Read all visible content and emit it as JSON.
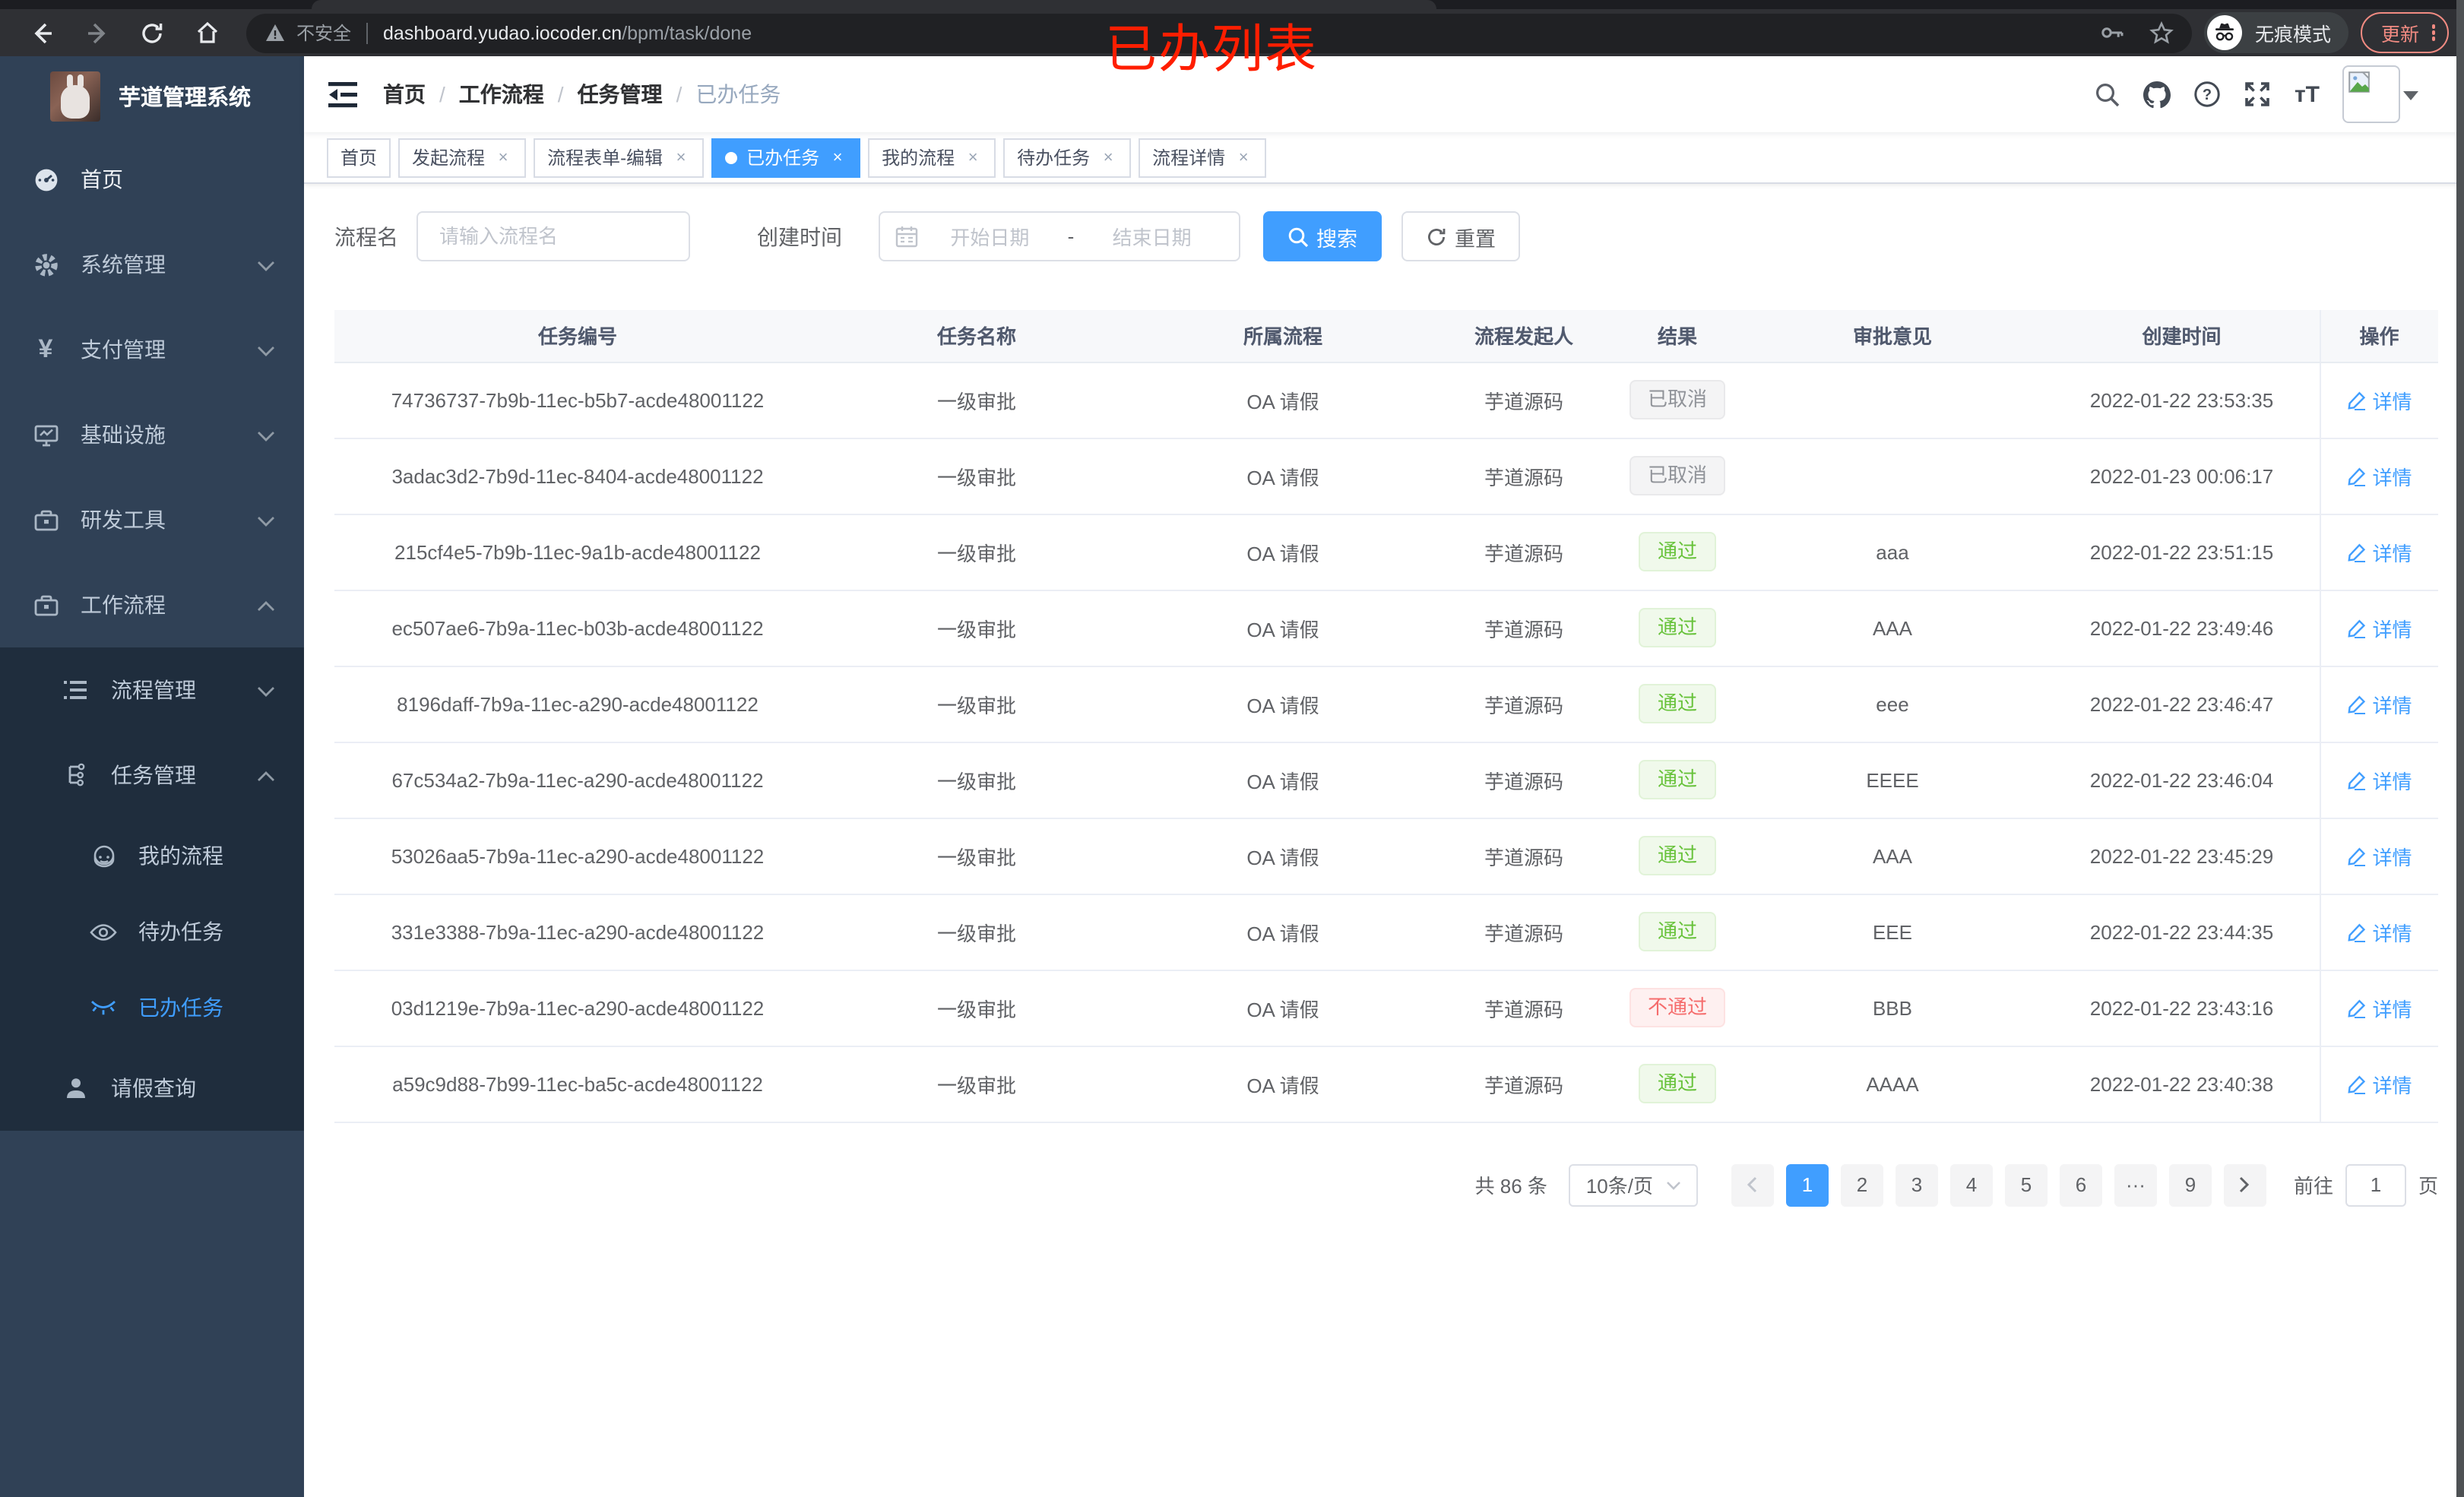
{
  "browser": {
    "security_label": "不安全",
    "url_host": "dashboard.yudao.iocoder.cn",
    "url_path": "/bpm/task/done",
    "incognito_label": "无痕模式",
    "update_label": "更新"
  },
  "annotation": {
    "text": "已办列表",
    "color": "#ff1e00"
  },
  "sidebar": {
    "app_title": "芋道管理系统",
    "items": [
      {
        "label": "首页"
      },
      {
        "label": "系统管理"
      },
      {
        "label": "支付管理"
      },
      {
        "label": "基础设施"
      },
      {
        "label": "研发工具"
      },
      {
        "label": "工作流程"
      },
      {
        "label": "流程管理"
      },
      {
        "label": "任务管理"
      },
      {
        "label": "我的流程"
      },
      {
        "label": "待办任务"
      },
      {
        "label": "已办任务"
      },
      {
        "label": "请假查询"
      }
    ]
  },
  "navbar": {
    "breadcrumb": [
      "首页",
      "工作流程",
      "任务管理",
      "已办任务"
    ]
  },
  "tabs": [
    {
      "label": "首页"
    },
    {
      "label": "发起流程"
    },
    {
      "label": "流程表单-编辑"
    },
    {
      "label": "已办任务"
    },
    {
      "label": "我的流程"
    },
    {
      "label": "待办任务"
    },
    {
      "label": "流程详情"
    }
  ],
  "filters": {
    "name_label": "流程名",
    "name_placeholder": "请输入流程名",
    "time_label": "创建时间",
    "start_placeholder": "开始日期",
    "range_separator": "-",
    "end_placeholder": "结束日期",
    "search_label": "搜索",
    "reset_label": "重置"
  },
  "table": {
    "columns": [
      "任务编号",
      "任务名称",
      "所属流程",
      "流程发起人",
      "结果",
      "审批意见",
      "创建时间",
      "操作"
    ],
    "rows": [
      {
        "id": "74736737-7b9b-11ec-b5b7-acde48001122",
        "name": "一级审批",
        "process": "OA 请假",
        "starter": "芋道源码",
        "result": "已取消",
        "result_type": "info",
        "comment": "",
        "time": "2022-01-22 23:53:35",
        "action": "详情"
      },
      {
        "id": "3adac3d2-7b9d-11ec-8404-acde48001122",
        "name": "一级审批",
        "process": "OA 请假",
        "starter": "芋道源码",
        "result": "已取消",
        "result_type": "info",
        "comment": "",
        "time": "2022-01-23 00:06:17",
        "action": "详情"
      },
      {
        "id": "215cf4e5-7b9b-11ec-9a1b-acde48001122",
        "name": "一级审批",
        "process": "OA 请假",
        "starter": "芋道源码",
        "result": "通过",
        "result_type": "success",
        "comment": "aaa",
        "time": "2022-01-22 23:51:15",
        "action": "详情"
      },
      {
        "id": "ec507ae6-7b9a-11ec-b03b-acde48001122",
        "name": "一级审批",
        "process": "OA 请假",
        "starter": "芋道源码",
        "result": "通过",
        "result_type": "success",
        "comment": "AAA",
        "time": "2022-01-22 23:49:46",
        "action": "详情"
      },
      {
        "id": "8196daff-7b9a-11ec-a290-acde48001122",
        "name": "一级审批",
        "process": "OA 请假",
        "starter": "芋道源码",
        "result": "通过",
        "result_type": "success",
        "comment": "eee",
        "time": "2022-01-22 23:46:47",
        "action": "详情"
      },
      {
        "id": "67c534a2-7b9a-11ec-a290-acde48001122",
        "name": "一级审批",
        "process": "OA 请假",
        "starter": "芋道源码",
        "result": "通过",
        "result_type": "success",
        "comment": "EEEE",
        "time": "2022-01-22 23:46:04",
        "action": "详情"
      },
      {
        "id": "53026aa5-7b9a-11ec-a290-acde48001122",
        "name": "一级审批",
        "process": "OA 请假",
        "starter": "芋道源码",
        "result": "通过",
        "result_type": "success",
        "comment": "AAA",
        "time": "2022-01-22 23:45:29",
        "action": "详情"
      },
      {
        "id": "331e3388-7b9a-11ec-a290-acde48001122",
        "name": "一级审批",
        "process": "OA 请假",
        "starter": "芋道源码",
        "result": "通过",
        "result_type": "success",
        "comment": "EEE",
        "time": "2022-01-22 23:44:35",
        "action": "详情"
      },
      {
        "id": "03d1219e-7b9a-11ec-a290-acde48001122",
        "name": "一级审批",
        "process": "OA 请假",
        "starter": "芋道源码",
        "result": "不通过",
        "result_type": "danger",
        "comment": "BBB",
        "time": "2022-01-22 23:43:16",
        "action": "详情"
      },
      {
        "id": "a59c9d88-7b99-11ec-ba5c-acde48001122",
        "name": "一级审批",
        "process": "OA 请假",
        "starter": "芋道源码",
        "result": "通过",
        "result_type": "success",
        "comment": "AAAA",
        "time": "2022-01-22 23:40:38",
        "action": "详情"
      }
    ]
  },
  "pagination": {
    "total": "共 86 条",
    "page_size": "10条/页",
    "pages": [
      "1",
      "2",
      "3",
      "4",
      "5",
      "6",
      "···",
      "9"
    ],
    "active_page": "1",
    "goto_label": "前往",
    "goto_value": "1",
    "page_unit": "页"
  }
}
